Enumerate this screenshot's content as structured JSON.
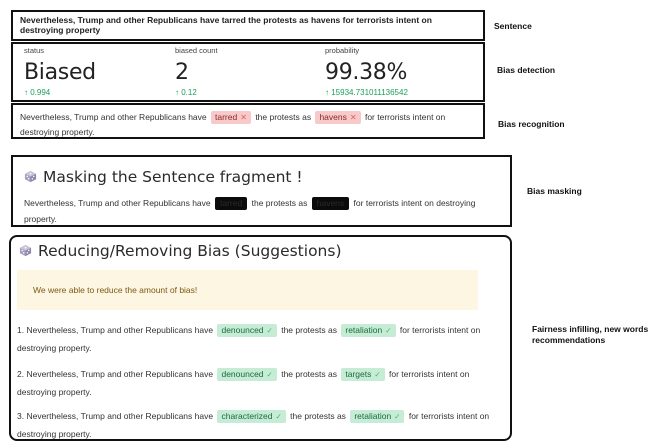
{
  "sentence": {
    "text": "Nevertheless, Trump and other Republicans have tarred the protests as havens for terrorists intent on destroying property",
    "side_label": "Sentence"
  },
  "detection": {
    "side_label": "Bias detection",
    "status": {
      "label": "status",
      "value": "Biased",
      "delta": "0.994"
    },
    "biased_count": {
      "label": "biased count",
      "value": "2",
      "delta": "0.12"
    },
    "probability": {
      "label": "probability",
      "value": "99.38%",
      "delta": "15934.731011136542"
    }
  },
  "recognition": {
    "side_label": "Bias recognition",
    "part1": "Nevertheless, Trump and other Republicans have",
    "tag1": "tarred",
    "part2": "the protests as",
    "tag2": "havens",
    "part3": "for terrorists intent on destroying property."
  },
  "masking": {
    "side_label": "Bias masking",
    "title": "Masking the Sentence fragment !",
    "part1": "Nevertheless, Trump and other Republicans have",
    "masked1": "tarred",
    "part2": "the protests as",
    "masked2": "havens",
    "part3": "for terrorists intent on destroying property."
  },
  "suggestions": {
    "side_label": "Fairness infilling, new words recommendations",
    "title": "Reducing/Removing Bias (Suggestions)",
    "success_message": "We were able to reduce the amount of bias!",
    "items": [
      {
        "prefix": "1. Nevertheless, Trump and other Republicans have",
        "word1": "denounced",
        "mid": "the protests as",
        "word2": "retaliation",
        "suffix": "for terrorists intent on destroying property."
      },
      {
        "prefix": "2. Nevertheless, Trump and other Republicans have",
        "word1": "denounced",
        "mid": "the protests as",
        "word2": "targets",
        "suffix": "for terrorists intent on destroying property."
      },
      {
        "prefix": "3. Nevertheless, Trump and other Republicans have",
        "word1": "characterized",
        "mid": "the protests as",
        "word2": "retaliation",
        "suffix": "for terrorists intent on destroying property."
      }
    ]
  },
  "icons": {
    "die": "die-icon",
    "arrow": "arrow-up-icon",
    "remove": "close-icon",
    "check": "check-icon"
  },
  "colors": {
    "delta_green": "#1a9e5a",
    "tag_red_bg": "#f8c9c9",
    "tag_green_bg": "#c6ecd6",
    "mask_black": "#0b0b0b",
    "success_bg": "#fdf6e3"
  }
}
